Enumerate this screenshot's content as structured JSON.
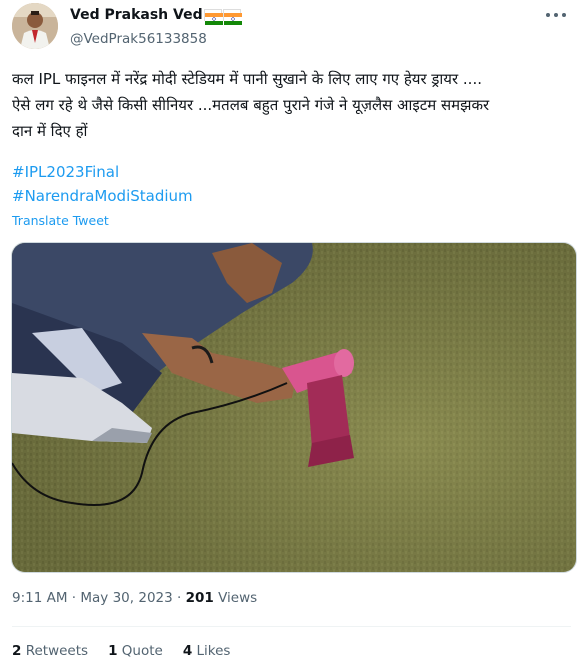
{
  "author": {
    "display_name": "Ved Prakash Ved",
    "handle": "@VedPrak56133858",
    "avatar_icon": "avatar-photo",
    "flag_icons": [
      "india-flag-icon",
      "india-flag-icon"
    ]
  },
  "tweet": {
    "text_line1": "कल IPL फाइनल में नरेंद्र मोदी स्टेडियम में पानी सुखाने के लिए लाए गए हेयर ड्रायर ....",
    "text_line2": "ऐसे लग रहे थे जैसे किसी सीनियर ...मतलब बहुत पुराने गंजे ने यूज़लैस आइटम समझकर",
    "text_line3": "दान में दिए हों",
    "hashtag1": "#IPL2023Final",
    "hashtag2": "#NarendraModiStadium",
    "translate_label": "Translate Tweet"
  },
  "meta": {
    "time": "9:11 AM",
    "date": "May 30, 2023",
    "views_count": "201",
    "views_label": "Views"
  },
  "stats": {
    "retweets_count": "2",
    "retweets_label": "Retweets",
    "quotes_count": "1",
    "quotes_label": "Quote",
    "likes_count": "4",
    "likes_label": "Likes"
  },
  "colors": {
    "link": "#1d9bf0",
    "secondary_text": "#536471",
    "primary_text": "#0f1419",
    "grass": "#7d8046",
    "dryer": "#b8386a"
  }
}
